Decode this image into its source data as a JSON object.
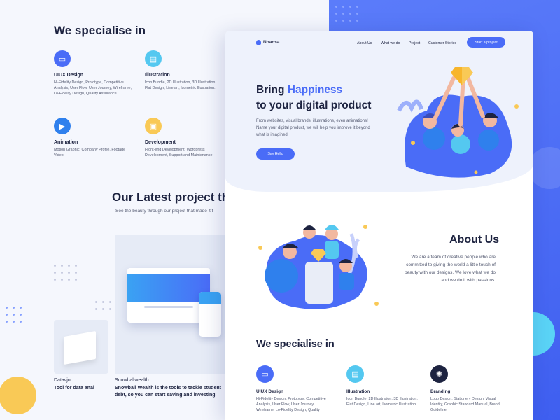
{
  "back_page": {
    "section_title": "We specialise in",
    "services": [
      {
        "title": "UIUX Design",
        "desc": "Hi-Fidelity Design, Prototype, Competitive Analysis, User Flow, User Journey, Wireframe, Lo-Fidelity Design, Quality Assurance",
        "icon": "monitor-icon",
        "color": "#4a6cf7"
      },
      {
        "title": "Illustration",
        "desc": "Icon Bundle, 2D Illustration, 3D Illustration. Flat Design, Line art, Isometric Illustration.",
        "icon": "palette-icon",
        "color": "#54c8f0"
      },
      {
        "title": "Animation",
        "desc": "Motion Graphic, Company Profile, Footage Video",
        "icon": "play-icon",
        "color": "#2f80ed"
      },
      {
        "title": "Development",
        "desc": "Front-end Development, Wordpress Development, Support and Maintenance.",
        "icon": "code-icon",
        "color": "#f9c956"
      }
    ],
    "latest_title": "Our Latest project that",
    "latest_subtitle": "See the beauty through our project that made it t",
    "projects": [
      {
        "name": "Datavju",
        "desc": "Tool for data anal"
      },
      {
        "name": "Snowballwealth",
        "desc": "Snowball Wealth is the tools to tackle student debt, so you can start saving and investing."
      }
    ]
  },
  "front_page": {
    "brand": "Noansa",
    "nav": [
      "About Us",
      "What we do",
      "Project",
      "Customer Stories"
    ],
    "cta": "Start a project",
    "hero": {
      "title_part1": "Bring ",
      "title_highlight": "Happiness",
      "title_line2": "to your digital product",
      "body": "From websites, visual brands, illustrations, even animations! Name your digital product, we will help you improve it beyond what is imagined.",
      "button": "Say Hello"
    },
    "about": {
      "title": "About Us",
      "body": "We are a team of creative people who are committed to giving the world a little touch of beauty with our designs. We love what we do and we do it with passions."
    },
    "specialise": {
      "title": "We specialise in",
      "services": [
        {
          "title": "UIUX Design",
          "desc": "Hi-Fidelity Design, Prototype, Competitive Analysis, User Flow, User Journey, Wireframe, Lo-Fidelity Design, Quality",
          "icon": "monitor-icon",
          "color": "#4a6cf7"
        },
        {
          "title": "Illustration",
          "desc": "Icon Bundle, 2D Illustration, 3D Illustration. Flat Design, Line art, Isometric Illustration.",
          "icon": "palette-icon",
          "color": "#54c8f0"
        },
        {
          "title": "Branding",
          "desc": "Logo Design, Stationery Design, Visual Identity, Graphic Standard Manual, Brand Guideline.",
          "icon": "bulb-icon",
          "color": "#1d2340"
        }
      ]
    }
  },
  "colors": {
    "accent": "#4a6cf7",
    "yellow": "#f9c956",
    "cyan": "#54c8f0",
    "navy": "#1d2340"
  }
}
